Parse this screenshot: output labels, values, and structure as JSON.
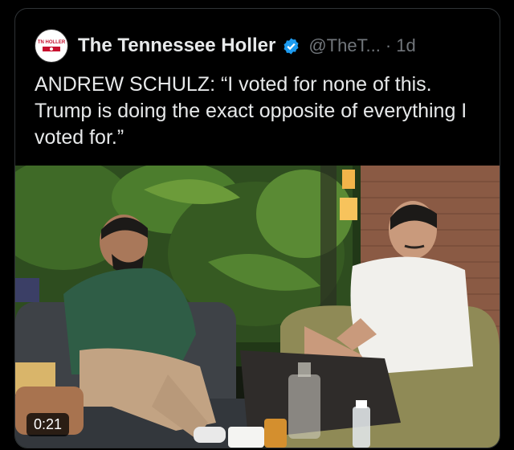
{
  "tweet": {
    "author_name": "The Tennessee Holler",
    "avatar_text": "TN HOLLER",
    "handle": "@TheT...",
    "separator": "·",
    "time": "1d",
    "text": "ANDREW SCHULZ: “I voted for none of this. Trump is doing the exact opposite of everything I voted for.”",
    "media": {
      "type": "video",
      "duration": "0:21"
    }
  },
  "colors": {
    "background": "#000000",
    "text": "#e7e9ea",
    "muted": "#71767b",
    "verified": "#1d9bf0",
    "border": "#2f3336"
  }
}
